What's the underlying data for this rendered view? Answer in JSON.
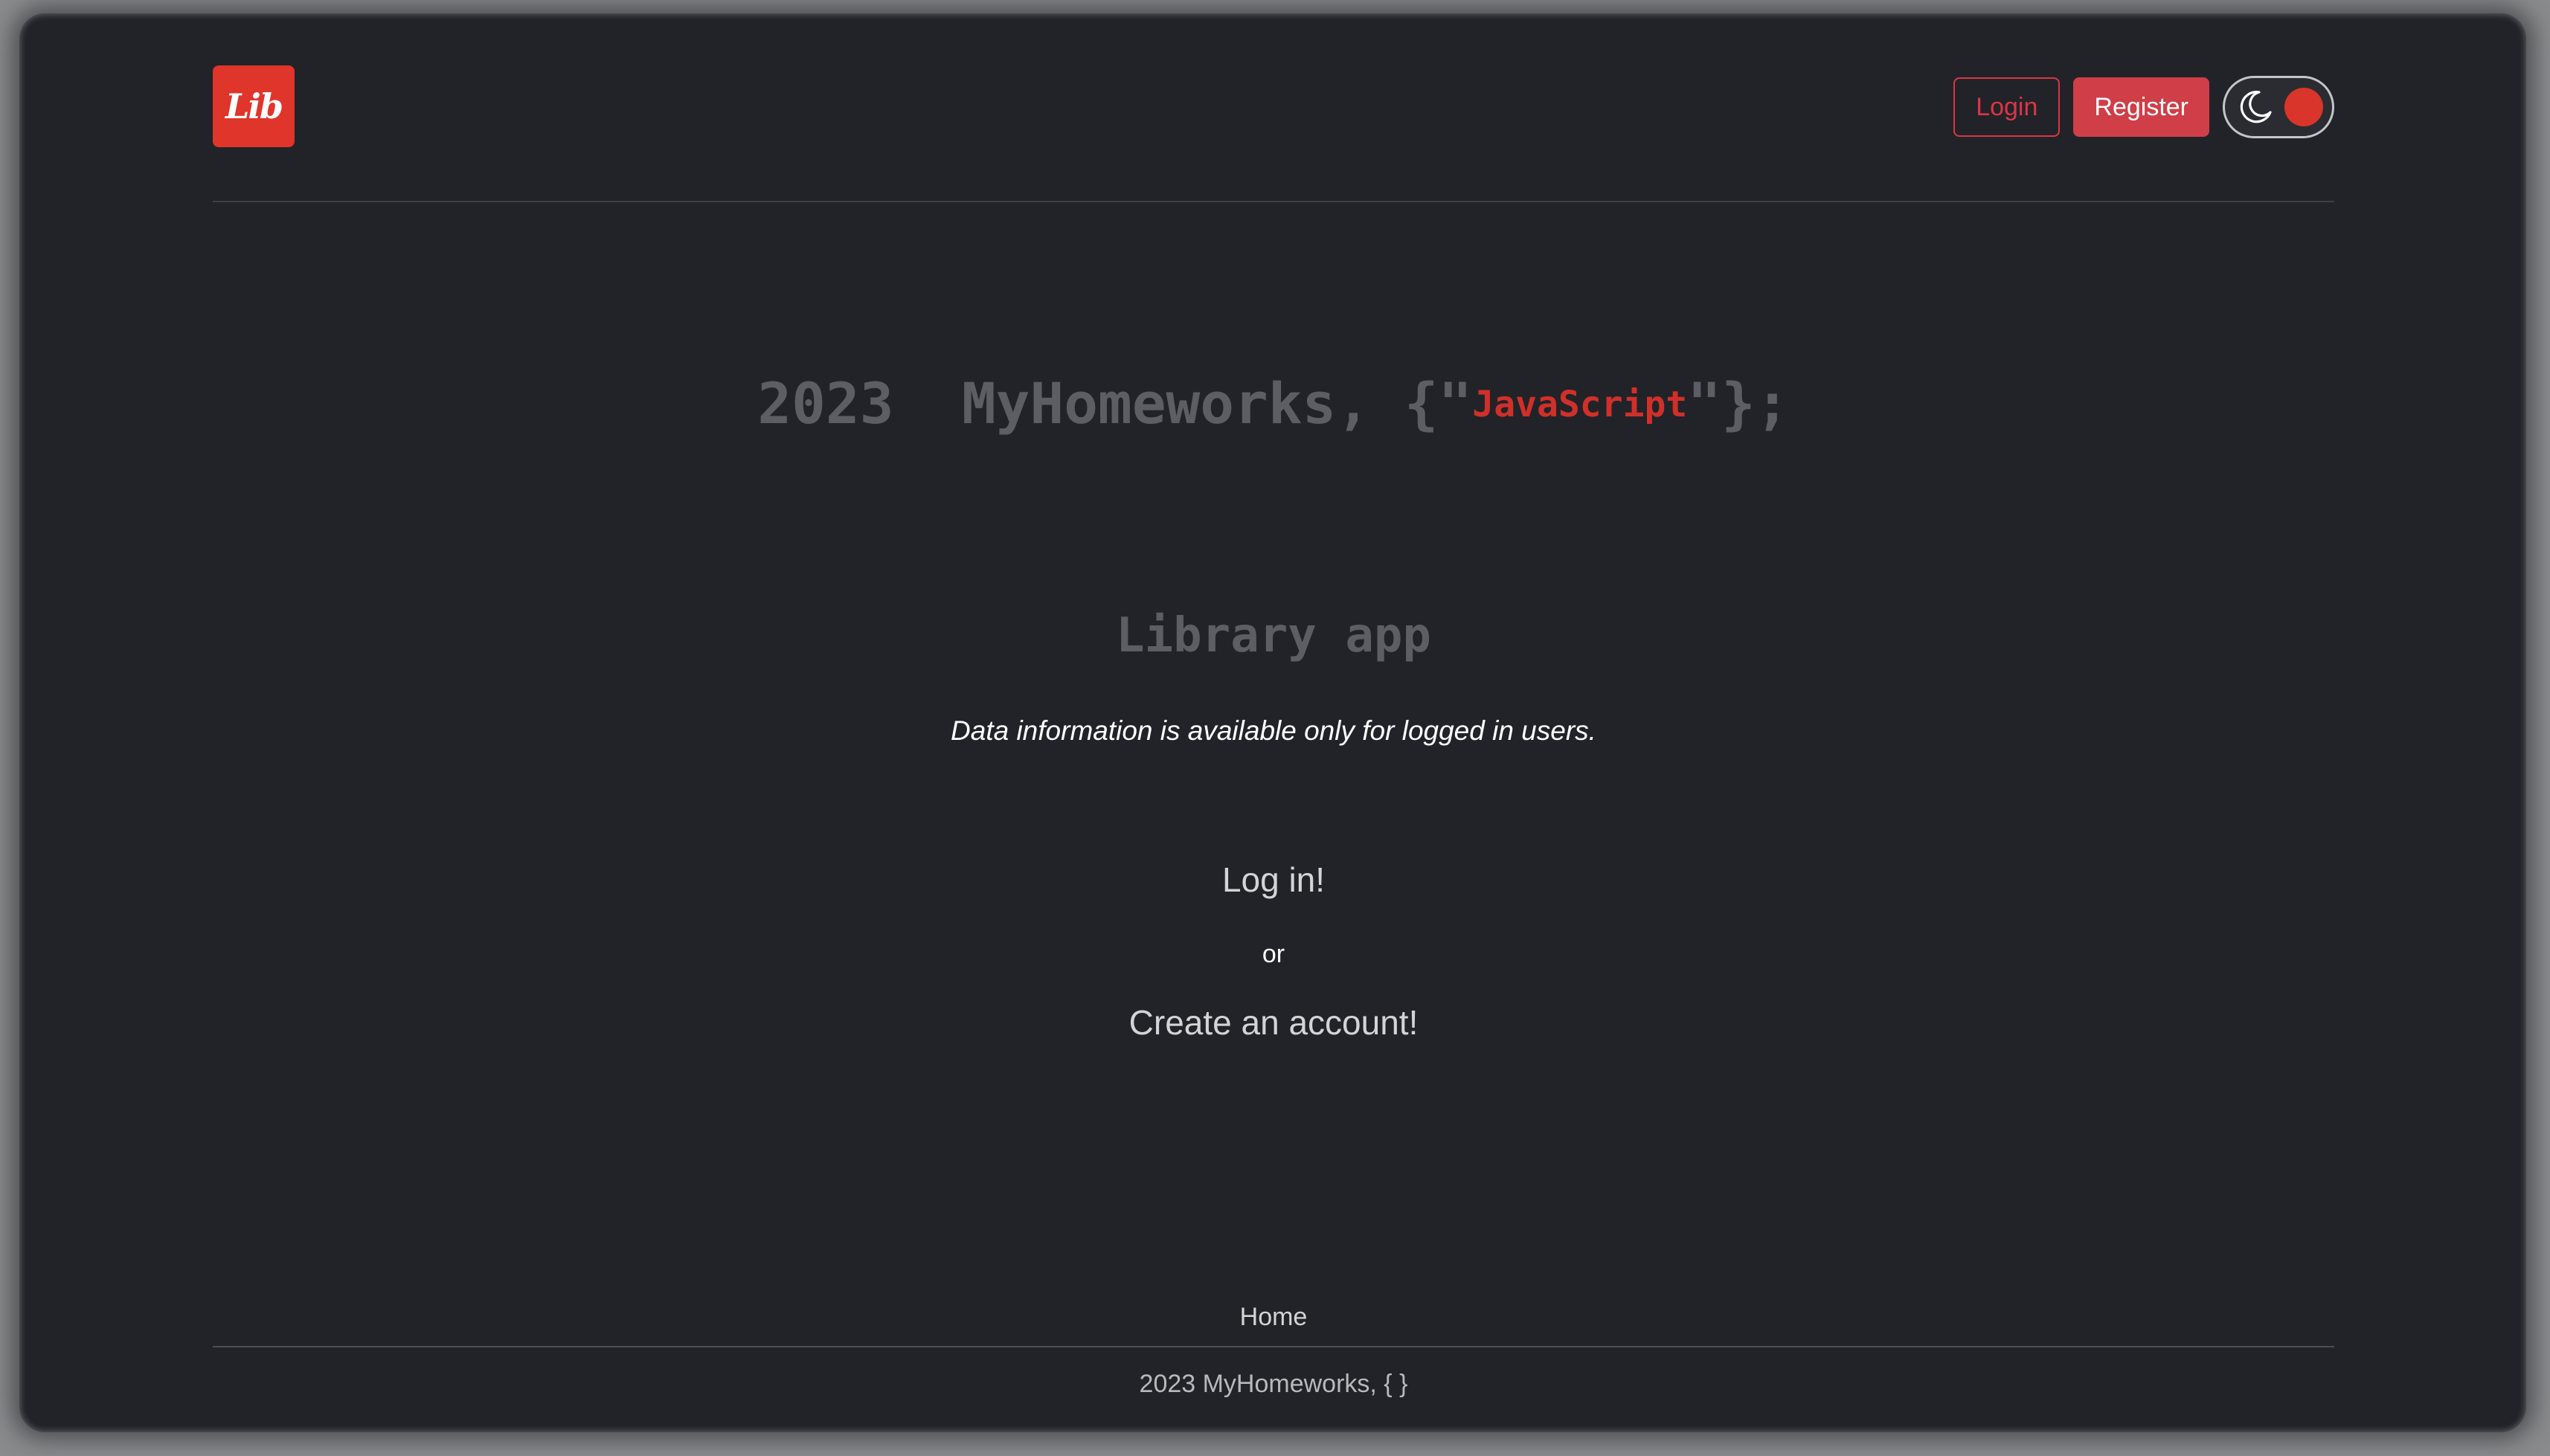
{
  "header": {
    "logo_text": "Lib",
    "login_label": "Login",
    "register_label": "Register",
    "theme_toggle": {
      "icon": "moon-icon",
      "state": "dark",
      "knob_color": "#d9352a"
    }
  },
  "hero": {
    "prefix": "2023  MyHomeworks, {\"",
    "highlight": "JavaScript",
    "suffix": "\"};"
  },
  "main": {
    "app_title": "Library app",
    "info_text": "Data information is available only for logged in users.",
    "login_link": "Log in!",
    "or_text": "or",
    "create_link": "Create an account!"
  },
  "footer": {
    "nav_home": "Home",
    "copyright": "2023 MyHomeworks, { }"
  },
  "colors": {
    "background": "#212328",
    "accent": "#dc3545",
    "brand": "#e0352a",
    "muted_text": "#5c5e63"
  }
}
